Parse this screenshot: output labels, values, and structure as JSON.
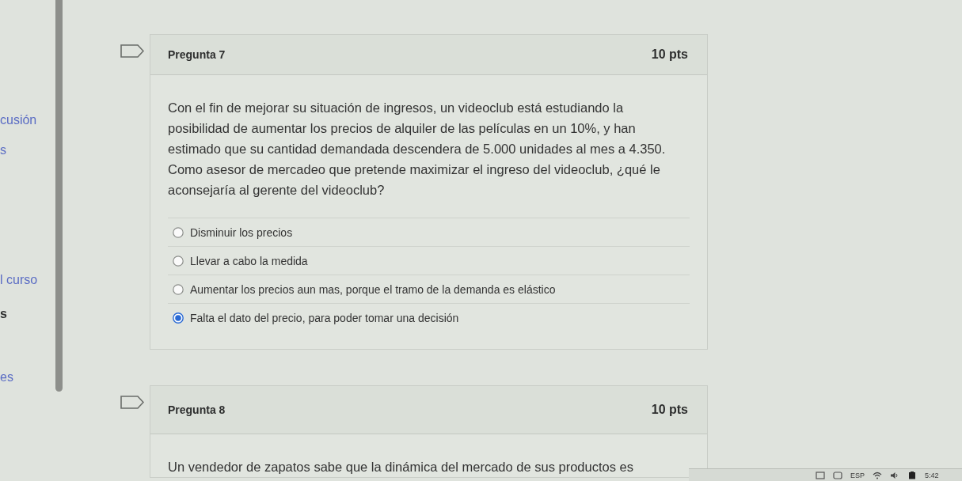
{
  "sidebar": {
    "links": [
      {
        "text": "cusión",
        "selected": false
      },
      {
        "text": "s",
        "selected": false
      },
      {
        "text": "l curso",
        "selected": false
      },
      {
        "text": "s",
        "selected": true
      },
      {
        "text": "es",
        "selected": false
      }
    ]
  },
  "questions": [
    {
      "title": "Pregunta 7",
      "points": "10 pts",
      "text": "Con el fin de mejorar su situación de ingresos, un videoclub está estudiando la posibilidad de aumentar los precios de alquiler de las películas en un 10%, y han estimado que su cantidad demandada descendera de 5.000 unidades al mes a 4.350. Como asesor de mercadeo que pretende maximizar el ingreso del videoclub, ¿qué le aconsejaría al gerente del videoclub?",
      "options": [
        {
          "label": "Disminuir los precios",
          "selected": false
        },
        {
          "label": "Llevar a cabo la medida",
          "selected": false
        },
        {
          "label": "Aumentar los precios aun mas, porque el tramo de la demanda es elástico",
          "selected": false
        },
        {
          "label": "Falta el dato del precio, para poder tomar una decisión",
          "selected": true
        }
      ]
    },
    {
      "title": "Pregunta 8",
      "points": "10 pts",
      "text": "Un vendedor de zapatos sabe que la dinámica del mercado de sus productos es"
    }
  ],
  "taskbar": {
    "language": "ESP",
    "time": "5:42"
  }
}
